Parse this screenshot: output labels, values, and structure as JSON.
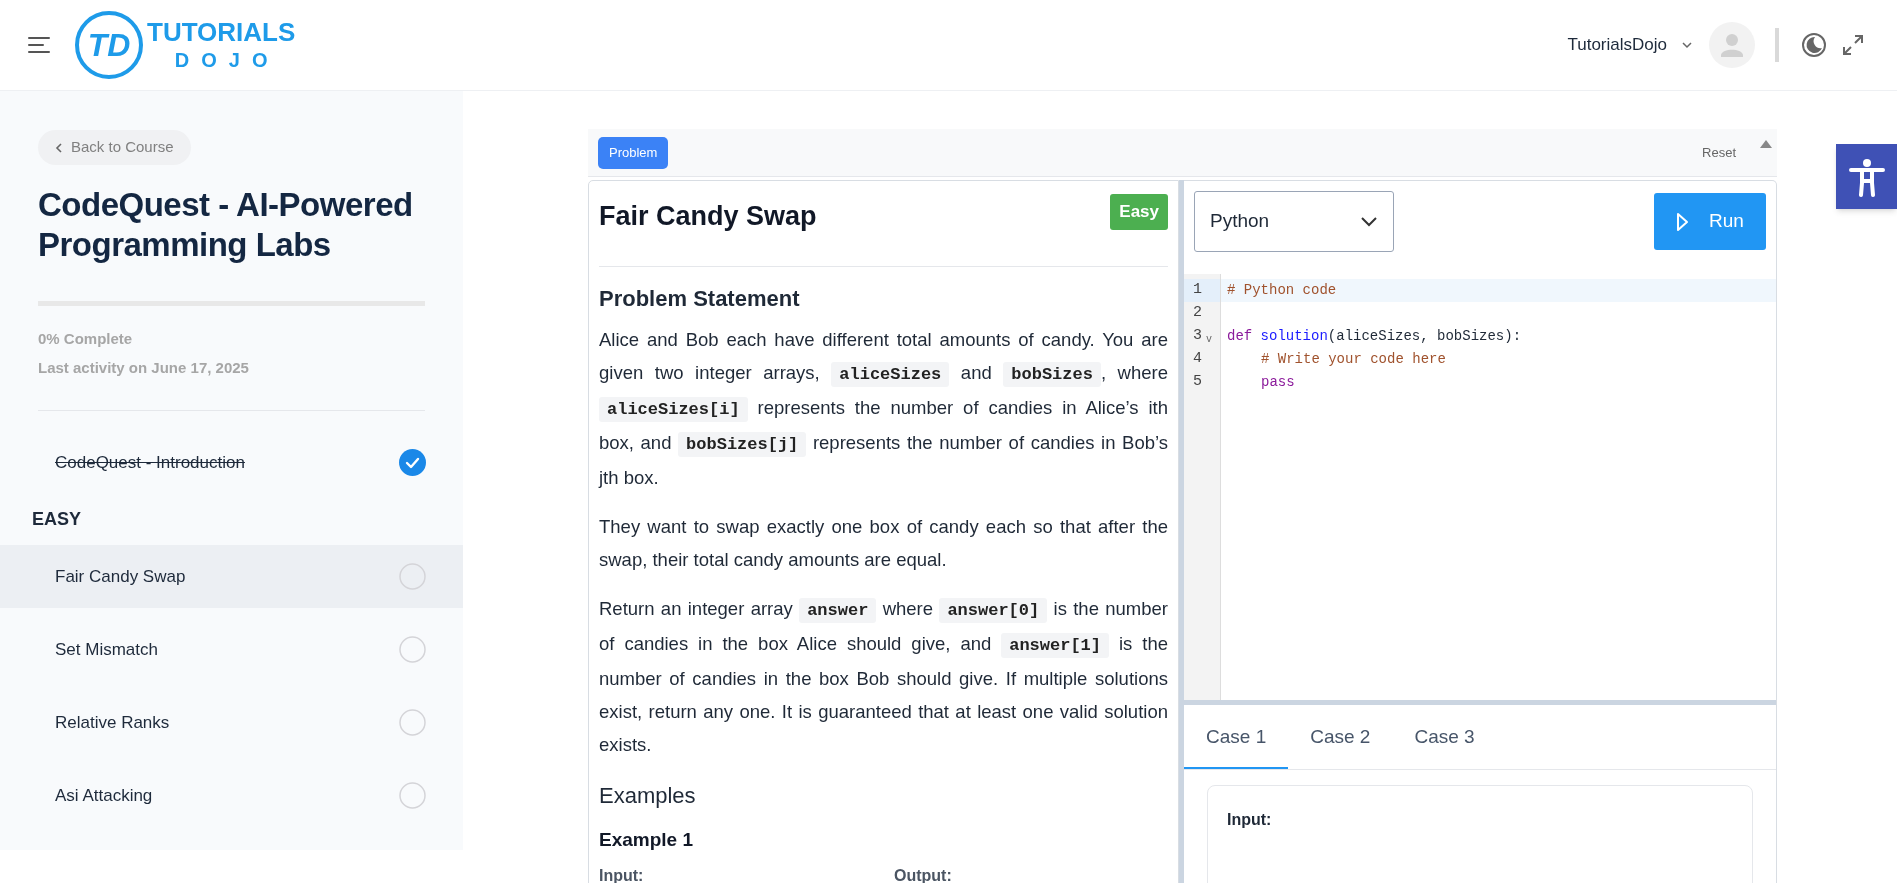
{
  "header": {
    "logo_mark": "TD",
    "brand_top": "TUTORIALS",
    "brand_bottom": "DOJO",
    "user_name": "TutorialsDojo"
  },
  "sidebar": {
    "back_button": "Back to Course",
    "course_title": "CodeQuest - AI-Powered Programming Labs",
    "progress": {
      "level": 0
    },
    "complete_text": "0% Complete",
    "last_activity": "Last activity on June 17, 2025",
    "intro": {
      "label": "CodeQuest - Introduction",
      "checked": true,
      "selected": false
    },
    "sections": [
      {
        "title": "EASY",
        "lessons": [
          {
            "label": "Fair Candy Swap",
            "checked": false,
            "selected": true
          },
          {
            "label": "Set Mismatch",
            "checked": false,
            "selected": false
          },
          {
            "label": "Relative Ranks",
            "checked": false,
            "selected": false
          },
          {
            "label": "Asi Attacking",
            "checked": false,
            "selected": false
          }
        ]
      }
    ]
  },
  "toolbar": {
    "tabs": [
      {
        "label": "Problem",
        "selected": true
      }
    ],
    "reset": "Reset"
  },
  "problem": {
    "title": "Fair Candy Swap",
    "difficulty": "Easy",
    "statement_heading": "Problem Statement",
    "paragraphs": [
      [
        {
          "kind": "text",
          "text": "Alice and Bob each have different total amounts of candy. You are given two integer arrays, "
        },
        {
          "kind": "code",
          "text": "aliceSizes"
        },
        {
          "kind": "text",
          "text": " and "
        },
        {
          "kind": "code",
          "text": "bobSizes"
        },
        {
          "kind": "text",
          "text": ", where "
        },
        {
          "kind": "code",
          "text": "aliceSizes[i]"
        },
        {
          "kind": "text",
          "text": " represents the number of candies in Alice’s ith box, and "
        },
        {
          "kind": "code",
          "text": "bobSizes[j]"
        },
        {
          "kind": "text",
          "text": " represents the number of candies in Bob’s jth box."
        }
      ],
      [
        {
          "kind": "text",
          "text": "They want to swap exactly one box of candy each so that after the swap, their total candy amounts are equal."
        }
      ],
      [
        {
          "kind": "text",
          "text": "Return an integer array "
        },
        {
          "kind": "code",
          "text": "answer"
        },
        {
          "kind": "text",
          "text": " where "
        },
        {
          "kind": "code",
          "text": "answer[0]"
        },
        {
          "kind": "text",
          "text": " is the number of candies in the box Alice should give, and "
        },
        {
          "kind": "code",
          "text": "answer[1]"
        },
        {
          "kind": "text",
          "text": " is the number of candies in the box Bob should give. If multiple solutions exist, return any one. It is guaranteed that at least one valid solution exists."
        }
      ]
    ],
    "examples_heading": "Examples",
    "example_title": "Example 1",
    "input_label": "Input:",
    "output_label": "Output:"
  },
  "editor": {
    "language": "Python",
    "run_button": "Run",
    "lines": [
      {
        "number": "1",
        "active": true,
        "indented": false,
        "tokens": [
          {
            "kind": "comment",
            "text": "# Python code"
          }
        ]
      },
      {
        "number": "2",
        "active": false
      },
      {
        "number": "3",
        "active": false,
        "indented": false,
        "fold_marker": "v",
        "tokens": [
          {
            "kind": "keyword",
            "text": "def"
          },
          {
            "kind": "function",
            "text": "solution"
          },
          {
            "kind": "plain",
            "text": "(aliceSizes, bobSizes):"
          }
        ]
      },
      {
        "number": "4",
        "active": false,
        "indented": true,
        "tokens": [
          {
            "kind": "comment",
            "text": "# Write your code here"
          }
        ]
      },
      {
        "number": "5",
        "active": false,
        "indented": true,
        "tokens": [
          {
            "kind": "keyword",
            "text": "pass"
          }
        ]
      }
    ]
  },
  "cases": {
    "tabs": [
      {
        "label": "Case 1",
        "selected": true
      },
      {
        "label": "Case 2",
        "selected": false
      },
      {
        "label": "Case 3",
        "selected": false
      }
    ],
    "input_label": "Input:"
  }
}
